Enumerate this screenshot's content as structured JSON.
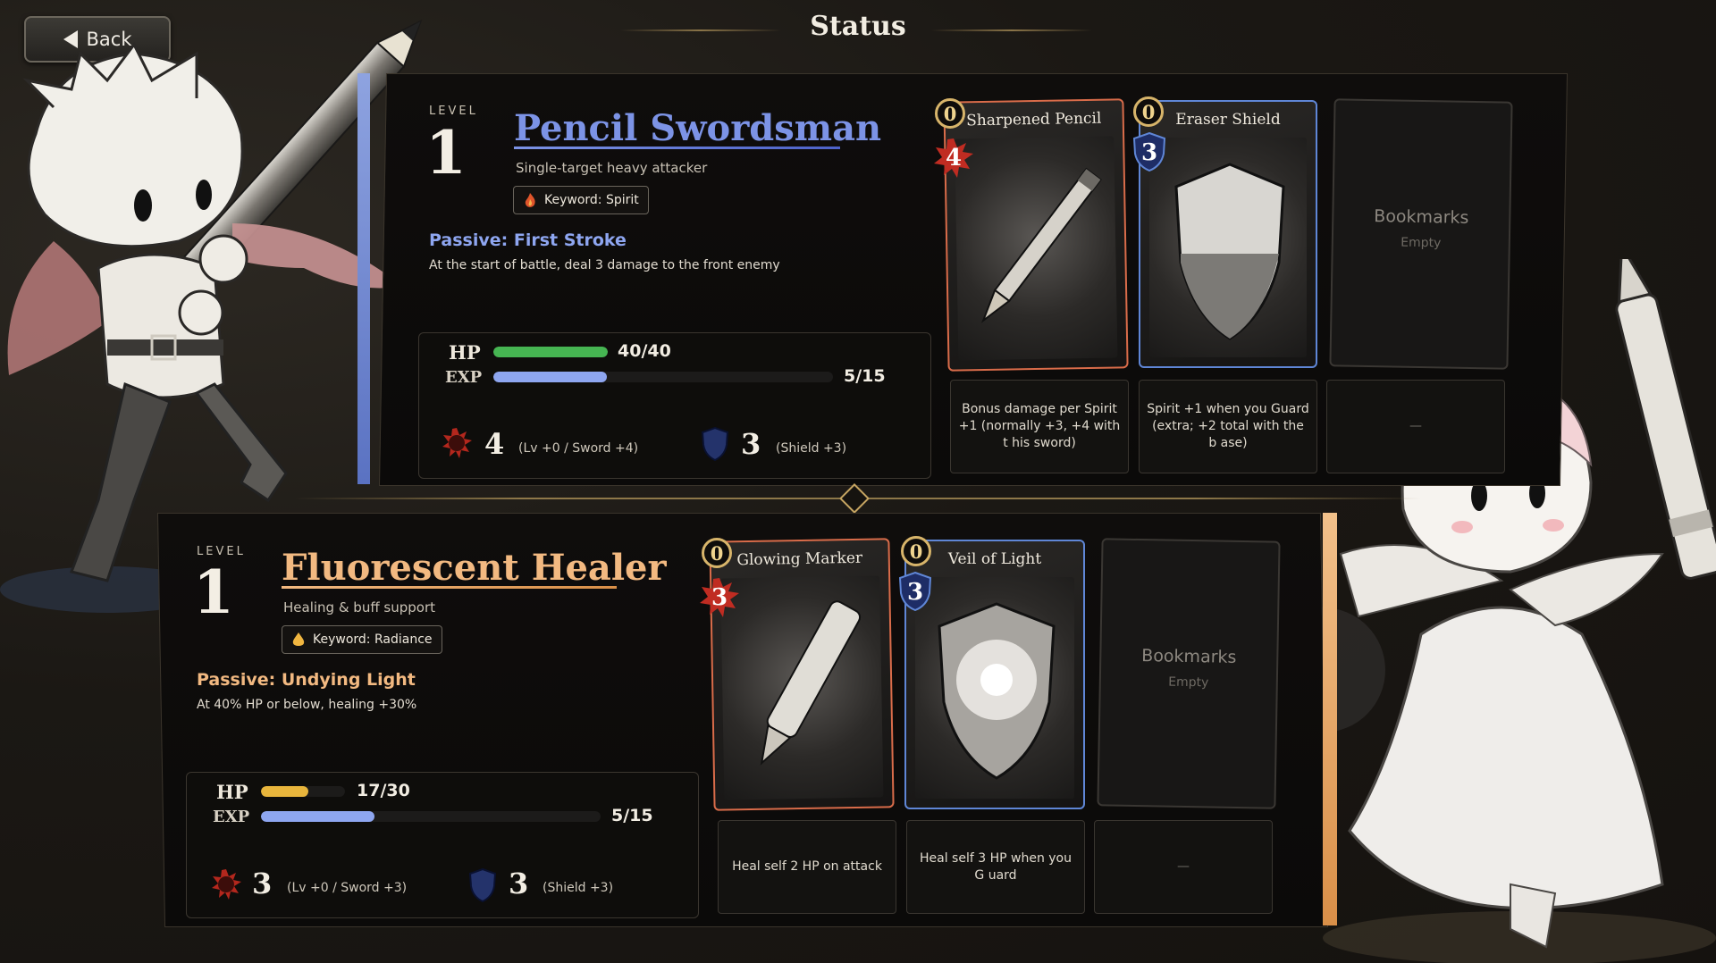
{
  "header": {
    "back_label": "Back",
    "title": "Status"
  },
  "hero1": {
    "level_label": "LEVEL",
    "level": "1",
    "name": "Pencil Swordsman",
    "role": "Single-target heavy attacker",
    "keyword": "Keyword: Spirit",
    "passive_title": "Passive: First Stroke",
    "passive_desc": "At the start of battle, deal 3 damage to the front enemy",
    "hp_label": "HP",
    "hp_text": "40/40",
    "hp_fraction": 1.0,
    "exp_label": "EXP",
    "exp_text": "5/15",
    "exp_fraction": 0.333,
    "attack": "4",
    "attack_note": "(Lv +0 / Sword +4)",
    "shield": "3",
    "shield_note": "(Shield +3)",
    "accent_color": "#4d62c9",
    "cards": [
      {
        "title": "Sharpened Pencil",
        "cost": "0",
        "value": "4",
        "type": "attack",
        "desc": "Bonus damage per Spirit +1 (normally +3, +4 with t his sword)"
      },
      {
        "title": "Eraser Shield",
        "cost": "0",
        "value": "3",
        "type": "shield",
        "desc": "Spirit +1 when you Guard (extra; +2 total with the b ase)"
      },
      {
        "title": "Bookmarks",
        "sub": "Empty",
        "desc": "—"
      }
    ]
  },
  "hero2": {
    "level_label": "LEVEL",
    "level": "1",
    "name": "Fluorescent Healer",
    "role": "Healing & buff support",
    "keyword": "Keyword: Radiance",
    "passive_title": "Passive: Undying Light",
    "passive_desc": "At 40% HP or below, healing +30%",
    "hp_label": "HP",
    "hp_text": "17/30",
    "hp_fraction": 0.567,
    "exp_label": "EXP",
    "exp_text": "5/15",
    "exp_fraction": 0.333,
    "attack": "3",
    "attack_note": "(Lv +0 / Sword +3)",
    "shield": "3",
    "shield_note": "(Shield +3)",
    "accent_color": "#e3b07a",
    "cards": [
      {
        "title": "Glowing Marker",
        "cost": "0",
        "value": "3",
        "type": "attack",
        "desc": "Heal self 2 HP on attack"
      },
      {
        "title": "Veil of Light",
        "cost": "0",
        "value": "3",
        "type": "shield",
        "desc": "Heal self 3 HP when you G uard"
      },
      {
        "title": "Bookmarks",
        "sub": "Empty",
        "desc": "—"
      }
    ]
  }
}
